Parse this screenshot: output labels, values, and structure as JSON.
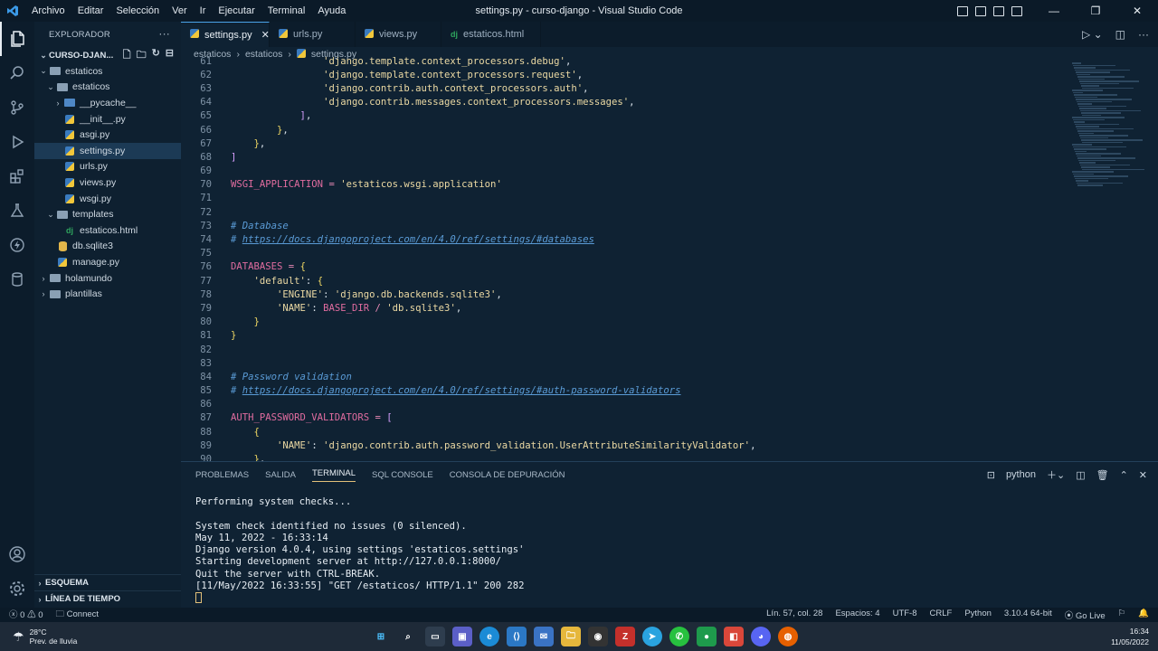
{
  "titlebar": {
    "menu": [
      "Archivo",
      "Editar",
      "Selección",
      "Ver",
      "Ir",
      "Ejecutar",
      "Terminal",
      "Ayuda"
    ],
    "title": "settings.py - curso-django - Visual Studio Code"
  },
  "sidebar": {
    "header": "EXPLORADOR",
    "project": "CURSO-DJAN...",
    "tree": [
      {
        "label": "estaticos",
        "depth": 1,
        "kind": "folder",
        "open": true
      },
      {
        "label": "estaticos",
        "depth": 2,
        "kind": "folder",
        "open": true
      },
      {
        "label": "__pycache__",
        "depth": 3,
        "kind": "folder-blue",
        "open": false
      },
      {
        "label": "__init__.py",
        "depth": 3,
        "kind": "py"
      },
      {
        "label": "asgi.py",
        "depth": 3,
        "kind": "py"
      },
      {
        "label": "settings.py",
        "depth": 3,
        "kind": "py",
        "selected": true
      },
      {
        "label": "urls.py",
        "depth": 3,
        "kind": "py"
      },
      {
        "label": "views.py",
        "depth": 3,
        "kind": "py"
      },
      {
        "label": "wsgi.py",
        "depth": 3,
        "kind": "py"
      },
      {
        "label": "templates",
        "depth": 2,
        "kind": "folder",
        "open": true
      },
      {
        "label": "estaticos.html",
        "depth": 3,
        "kind": "dj"
      },
      {
        "label": "db.sqlite3",
        "depth": 2,
        "kind": "db"
      },
      {
        "label": "manage.py",
        "depth": 2,
        "kind": "py"
      },
      {
        "label": "holamundo",
        "depth": 1,
        "kind": "folder",
        "open": false
      },
      {
        "label": "plantillas",
        "depth": 1,
        "kind": "folder",
        "open": false
      }
    ],
    "bottom": [
      "ESQUEMA",
      "LÍNEA DE TIEMPO"
    ]
  },
  "tabs": [
    {
      "label": "settings.py",
      "active": true,
      "icon": "py"
    },
    {
      "label": "urls.py",
      "active": false,
      "icon": "py"
    },
    {
      "label": "views.py",
      "active": false,
      "icon": "py"
    },
    {
      "label": "estaticos.html",
      "active": false,
      "icon": "dj"
    }
  ],
  "breadcrumb": [
    "estaticos",
    "estaticos",
    "settings.py"
  ],
  "code": [
    {
      "n": "61",
      "t": "                'django.template.context_processors.debug',"
    },
    {
      "n": "62",
      "t": "                'django.template.context_processors.request',"
    },
    {
      "n": "63",
      "t": "                'django.contrib.auth.context_processors.auth',"
    },
    {
      "n": "64",
      "t": "                'django.contrib.messages.context_processors.messages',"
    },
    {
      "n": "65",
      "t": "            ],"
    },
    {
      "n": "66",
      "t": "        },"
    },
    {
      "n": "67",
      "t": "    },"
    },
    {
      "n": "68",
      "t": "]"
    },
    {
      "n": "69",
      "t": ""
    },
    {
      "n": "70",
      "t": "WSGI_APPLICATION = 'estaticos.wsgi.application'"
    },
    {
      "n": "71",
      "t": ""
    },
    {
      "n": "72",
      "t": ""
    },
    {
      "n": "73",
      "t": "# Database"
    },
    {
      "n": "74",
      "t": "# https://docs.djangoproject.com/en/4.0/ref/settings/#databases"
    },
    {
      "n": "75",
      "t": ""
    },
    {
      "n": "76",
      "t": "DATABASES = {"
    },
    {
      "n": "77",
      "t": "    'default': {"
    },
    {
      "n": "78",
      "t": "        'ENGINE': 'django.db.backends.sqlite3',"
    },
    {
      "n": "79",
      "t": "        'NAME': BASE_DIR / 'db.sqlite3',"
    },
    {
      "n": "80",
      "t": "    }"
    },
    {
      "n": "81",
      "t": "}"
    },
    {
      "n": "82",
      "t": ""
    },
    {
      "n": "83",
      "t": ""
    },
    {
      "n": "84",
      "t": "# Password validation"
    },
    {
      "n": "85",
      "t": "# https://docs.djangoproject.com/en/4.0/ref/settings/#auth-password-validators"
    },
    {
      "n": "86",
      "t": ""
    },
    {
      "n": "87",
      "t": "AUTH_PASSWORD_VALIDATORS = ["
    },
    {
      "n": "88",
      "t": "    {"
    },
    {
      "n": "89",
      "t": "        'NAME': 'django.contrib.auth.password_validation.UserAttributeSimilarityValidator',"
    },
    {
      "n": "90",
      "t": "    },"
    }
  ],
  "panel": {
    "tabs": [
      "PROBLEMAS",
      "SALIDA",
      "TERMINAL",
      "SQL CONSOLE",
      "CONSOLA DE DEPURACIÓN"
    ],
    "active_tab": "TERMINAL",
    "shell": "python",
    "terminal": [
      "Performing system checks...",
      "",
      "System check identified no issues (0 silenced).",
      "May 11, 2022 - 16:33:14",
      "Django version 4.0.4, using settings 'estaticos.settings'",
      "Starting development server at http://127.0.0.1:8000/",
      "Quit the server with CTRL-BREAK.",
      "[11/May/2022 16:33:55] \"GET /estaticos/ HTTP/1.1\" 200 282"
    ]
  },
  "status": {
    "errors": "0",
    "warnings": "0",
    "connect": "Connect",
    "position": "Lín. 57, col. 28",
    "spaces": "Espacios: 4",
    "encoding": "UTF-8",
    "eol": "CRLF",
    "language": "Python",
    "interpreter": "3.10.4 64-bit",
    "golive": "Go Live"
  },
  "taskbar": {
    "temp": "28°C",
    "weather": "Prev. de lluvia",
    "time": "16:34",
    "date": "11/05/2022"
  },
  "colors": {
    "keyword_var": "#e06c9f",
    "string": "#ebd9a3",
    "comment": "#5a9bd6",
    "accent": "#4aa3e8"
  }
}
